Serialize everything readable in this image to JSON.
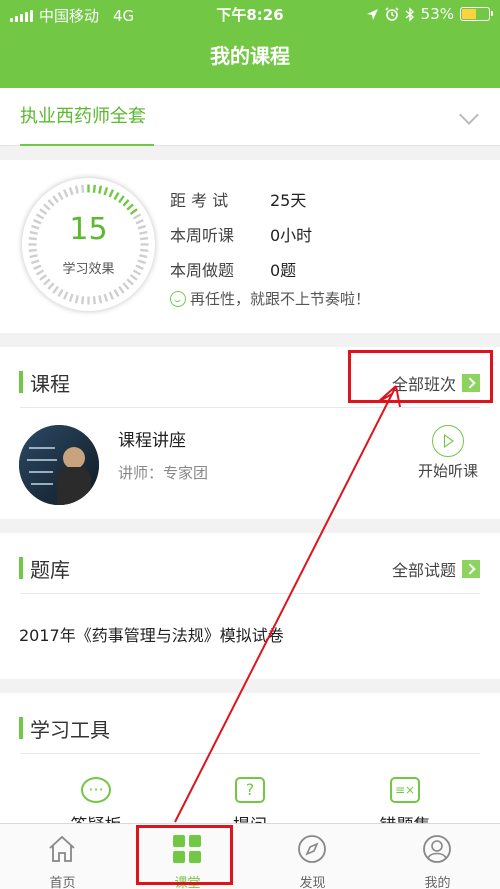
{
  "status_bar": {
    "carrier": "中国移动",
    "network": "4G",
    "time": "下午8:26",
    "battery": "53%"
  },
  "nav": {
    "title": "我的课程"
  },
  "course_selector": {
    "current": "执业西药师全套"
  },
  "stats": {
    "score": "15",
    "score_caption": "学习效果",
    "rows": [
      {
        "key": "距 考 试",
        "value": "25天"
      },
      {
        "key": "本周听课",
        "value": "0小时"
      },
      {
        "key": "本周做题",
        "value": "0题"
      }
    ],
    "motto": "再任性，就跟不上节奏啦！"
  },
  "courses": {
    "title": "课程",
    "more": "全部班次",
    "item": {
      "name": "课程讲座",
      "teacher": "讲师：专家团",
      "action": "开始听课"
    }
  },
  "question_bank": {
    "title": "题库",
    "more": "全部试题",
    "exam": "2017年《药事管理与法规》模拟试卷"
  },
  "tools": {
    "title": "学习工具",
    "items": [
      {
        "label": "答疑板",
        "icon": "chat-bubble-icon"
      },
      {
        "label": "提问",
        "icon": "question-icon"
      },
      {
        "label": "错题集",
        "icon": "error-book-icon"
      }
    ]
  },
  "tabbar": {
    "items": [
      {
        "label": "首页",
        "icon": "home-icon"
      },
      {
        "label": "课堂",
        "icon": "grid-icon"
      },
      {
        "label": "发现",
        "icon": "compass-icon"
      },
      {
        "label": "我的",
        "icon": "profile-icon"
      }
    ],
    "active_index": 1
  },
  "colors": {
    "brand_green": "#72c845",
    "annotation_red": "#e0121b"
  }
}
